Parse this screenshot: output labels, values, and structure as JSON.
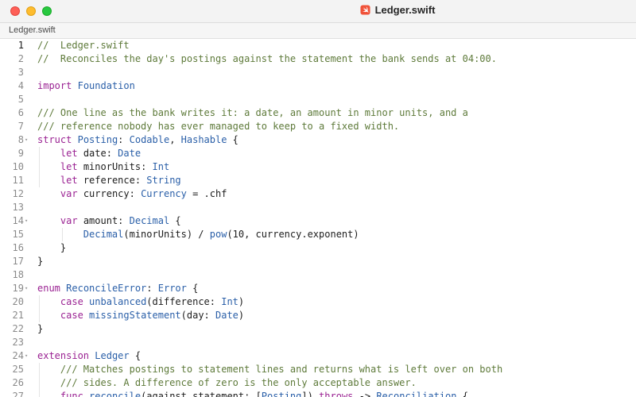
{
  "window": {
    "title": "Ledger.swift",
    "file_icon": "swift-file-icon",
    "tab_label": "Ledger.swift",
    "traffic_lights": [
      "close",
      "minimize",
      "maximize"
    ]
  },
  "editor": {
    "current_line": 1,
    "fold_markers_on_lines": [
      8,
      14,
      19,
      24
    ],
    "colors": {
      "comment": "#5e7a3a",
      "keyword": "#9b2393",
      "type": "#2a5fa8",
      "plain": "#1d1d1d"
    },
    "lines": [
      {
        "n": "1",
        "tokens": [
          {
            "t": "//  Ledger.swift",
            "k": "comment"
          }
        ]
      },
      {
        "n": "2",
        "tokens": [
          {
            "t": "//  Reconciles the day's postings against the statement the bank sends at 04:00.",
            "k": "comment"
          }
        ]
      },
      {
        "n": "3",
        "tokens": []
      },
      {
        "n": "4",
        "tokens": [
          {
            "t": "import",
            "k": "kw"
          },
          {
            "t": " ",
            "k": "plain"
          },
          {
            "t": "Foundation",
            "k": "type"
          }
        ]
      },
      {
        "n": "5",
        "tokens": []
      },
      {
        "n": "6",
        "tokens": [
          {
            "t": "/// One line as the bank writes it: a date, an amount in minor units, and a",
            "k": "comment"
          }
        ]
      },
      {
        "n": "7",
        "tokens": [
          {
            "t": "/// reference nobody has ever managed to keep to a fixed width.",
            "k": "comment"
          }
        ]
      },
      {
        "n": "8",
        "tokens": [
          {
            "t": "struct",
            "k": "kw"
          },
          {
            "t": " ",
            "k": "plain"
          },
          {
            "t": "Posting",
            "k": "type"
          },
          {
            "t": ": ",
            "k": "plain"
          },
          {
            "t": "Codable",
            "k": "type"
          },
          {
            "t": ", ",
            "k": "plain"
          },
          {
            "t": "Hashable",
            "k": "type"
          },
          {
            "t": " {",
            "k": "plain"
          }
        ]
      },
      {
        "n": "9",
        "tokens": [
          {
            "t": "    ",
            "k": "plain"
          },
          {
            "t": "let",
            "k": "kw"
          },
          {
            "t": " date: ",
            "k": "plain"
          },
          {
            "t": "Date",
            "k": "type"
          }
        ]
      },
      {
        "n": "10",
        "tokens": [
          {
            "t": "    ",
            "k": "plain"
          },
          {
            "t": "let",
            "k": "kw"
          },
          {
            "t": " minorUnits: ",
            "k": "plain"
          },
          {
            "t": "Int",
            "k": "type"
          }
        ]
      },
      {
        "n": "11",
        "tokens": [
          {
            "t": "    ",
            "k": "plain"
          },
          {
            "t": "let",
            "k": "kw"
          },
          {
            "t": " reference: ",
            "k": "plain"
          },
          {
            "t": "String",
            "k": "type"
          }
        ]
      },
      {
        "n": "12",
        "tokens": [
          {
            "t": "    ",
            "k": "plain"
          },
          {
            "t": "var",
            "k": "kw"
          },
          {
            "t": " currency: ",
            "k": "plain"
          },
          {
            "t": "Currency",
            "k": "type"
          },
          {
            "t": " = .chf",
            "k": "plain"
          }
        ]
      },
      {
        "n": "13",
        "tokens": []
      },
      {
        "n": "14",
        "tokens": [
          {
            "t": "    ",
            "k": "plain"
          },
          {
            "t": "var",
            "k": "kw"
          },
          {
            "t": " amount: ",
            "k": "plain"
          },
          {
            "t": "Decimal",
            "k": "type"
          },
          {
            "t": " {",
            "k": "plain"
          }
        ]
      },
      {
        "n": "15",
        "tokens": [
          {
            "t": "        ",
            "k": "plain"
          },
          {
            "t": "Decimal",
            "k": "type"
          },
          {
            "t": "(minorUnits) / ",
            "k": "plain"
          },
          {
            "t": "pow",
            "k": "type"
          },
          {
            "t": "(10, currency.exponent)",
            "k": "plain"
          }
        ]
      },
      {
        "n": "16",
        "tokens": [
          {
            "t": "    }",
            "k": "plain"
          }
        ]
      },
      {
        "n": "17",
        "tokens": [
          {
            "t": "}",
            "k": "plain"
          }
        ]
      },
      {
        "n": "18",
        "tokens": []
      },
      {
        "n": "19",
        "tokens": [
          {
            "t": "enum",
            "k": "kw"
          },
          {
            "t": " ",
            "k": "plain"
          },
          {
            "t": "ReconcileError",
            "k": "type"
          },
          {
            "t": ": ",
            "k": "plain"
          },
          {
            "t": "Error",
            "k": "type"
          },
          {
            "t": " {",
            "k": "plain"
          }
        ]
      },
      {
        "n": "20",
        "tokens": [
          {
            "t": "    ",
            "k": "plain"
          },
          {
            "t": "case",
            "k": "kw"
          },
          {
            "t": " ",
            "k": "plain"
          },
          {
            "t": "unbalanced",
            "k": "type"
          },
          {
            "t": "(difference: ",
            "k": "plain"
          },
          {
            "t": "Int",
            "k": "type"
          },
          {
            "t": ")",
            "k": "plain"
          }
        ]
      },
      {
        "n": "21",
        "tokens": [
          {
            "t": "    ",
            "k": "plain"
          },
          {
            "t": "case",
            "k": "kw"
          },
          {
            "t": " ",
            "k": "plain"
          },
          {
            "t": "missingStatement",
            "k": "type"
          },
          {
            "t": "(day: ",
            "k": "plain"
          },
          {
            "t": "Date",
            "k": "type"
          },
          {
            "t": ")",
            "k": "plain"
          }
        ]
      },
      {
        "n": "22",
        "tokens": [
          {
            "t": "}",
            "k": "plain"
          }
        ]
      },
      {
        "n": "23",
        "tokens": []
      },
      {
        "n": "24",
        "tokens": [
          {
            "t": "extension",
            "k": "kw"
          },
          {
            "t": " ",
            "k": "plain"
          },
          {
            "t": "Ledger",
            "k": "type"
          },
          {
            "t": " {",
            "k": "plain"
          }
        ]
      },
      {
        "n": "25",
        "tokens": [
          {
            "t": "    /// Matches postings to statement lines and returns what is left over on both",
            "k": "comment"
          }
        ]
      },
      {
        "n": "26",
        "tokens": [
          {
            "t": "    /// sides. A difference of zero is the only acceptable answer.",
            "k": "comment"
          }
        ]
      },
      {
        "n": "27",
        "tokens": [
          {
            "t": "    ",
            "k": "plain"
          },
          {
            "t": "func",
            "k": "kw"
          },
          {
            "t": " ",
            "k": "plain"
          },
          {
            "t": "reconcile",
            "k": "type"
          },
          {
            "t": "(against statement: [",
            "k": "plain"
          },
          {
            "t": "Posting",
            "k": "type"
          },
          {
            "t": "]) ",
            "k": "plain"
          },
          {
            "t": "throws",
            "k": "kw"
          },
          {
            "t": " -> ",
            "k": "plain"
          },
          {
            "t": "Reconciliation",
            "k": "type"
          },
          {
            "t": " {",
            "k": "plain"
          }
        ]
      }
    ]
  }
}
